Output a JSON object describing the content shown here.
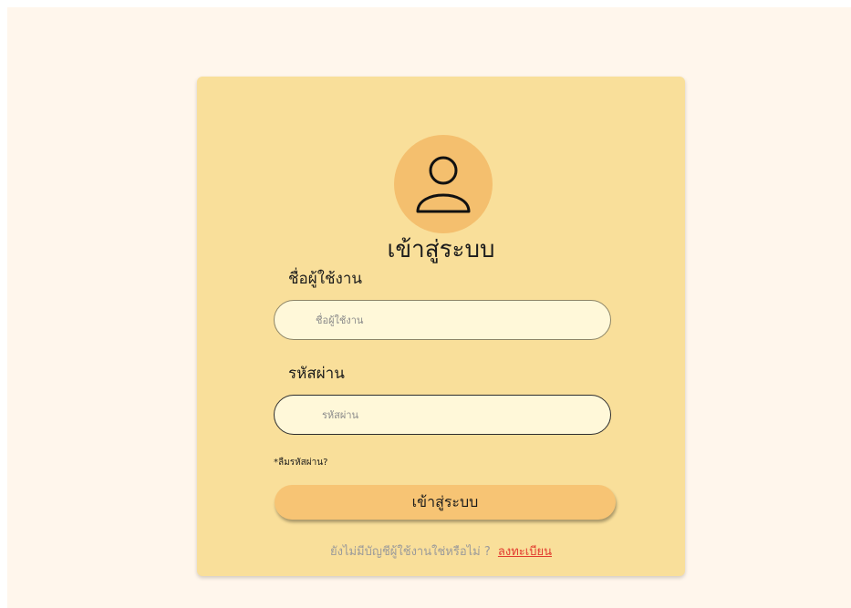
{
  "login": {
    "title": "เข้าสู่ระบบ",
    "username_label": "ชื่อผู้ใช้งาน",
    "username_placeholder": "ชื่อผู้ใช้งาน",
    "password_label": "รหัสผ่าน",
    "password_placeholder": "รหัสผ่าน",
    "forgot_text": "*ลืมรหัสผ่าน?",
    "submit_label": "เข้าสู่ระบบ",
    "signup_prompt": "ยังไม่มีบัญชีผู้ใช้งานใช่หรือไม่ ?",
    "signup_link": "ลงทะเบียน",
    "avatar_icon": "user-icon"
  },
  "colors": {
    "page_bg": "#fff6ec",
    "card_bg": "#f9df9a",
    "avatar_bg": "#f4bf6e",
    "button_bg": "#f7c474",
    "input_bg": "#fff8d9",
    "link": "#e23b2f"
  }
}
